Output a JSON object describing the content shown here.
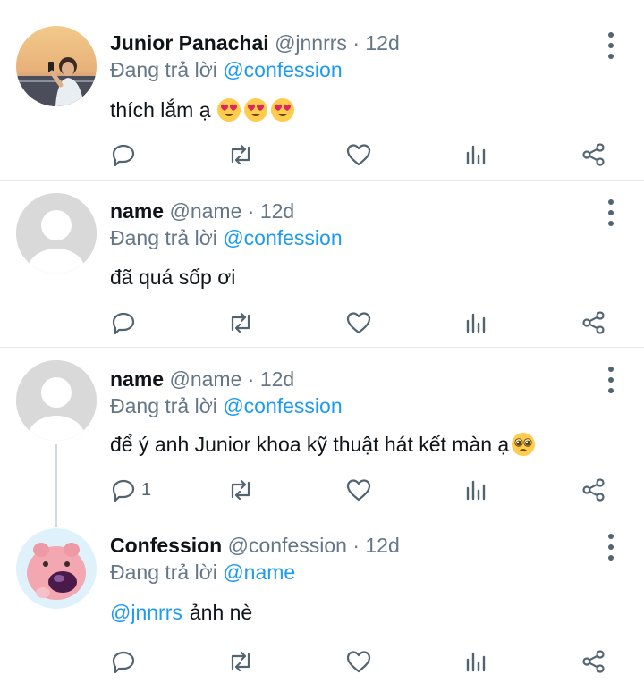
{
  "tweets": [
    {
      "display_name": "Junior Panachai",
      "handle": "@jnnrrs",
      "separator": "·",
      "time": "12d",
      "reply_prefix": "Đang trả lời",
      "reply_to": "@confession",
      "text": "thích lắm ạ",
      "emojis": [
        "heart-eyes-emoji",
        "heart-eyes-emoji",
        "heart-eyes-emoji"
      ],
      "reply_count": ""
    },
    {
      "display_name": "name",
      "handle": "@name",
      "separator": "·",
      "time": "12d",
      "reply_prefix": "Đang trả lời",
      "reply_to": "@confession",
      "text": "đã quá sốp ơi",
      "reply_count": ""
    },
    {
      "display_name": "name",
      "handle": "@name",
      "separator": "·",
      "time": "12d",
      "reply_prefix": "Đang trả lời",
      "reply_to": "@confession",
      "text": "để ý anh Junior khoa kỹ thuật hát kết màn ạ",
      "emojis": [
        "pleading-face-emoji"
      ],
      "reply_count": "1"
    },
    {
      "display_name": "Confession",
      "handle": "@confession",
      "separator": "·",
      "time": "12d",
      "reply_prefix": "Đang trả lời",
      "reply_to": "@name",
      "mention": "@jnnrrs",
      "text": "ảnh nè",
      "reply_count": ""
    }
  ],
  "icons": {
    "reply": "reply-icon",
    "retweet": "retweet-icon",
    "like": "heart-icon",
    "views": "views-icon",
    "share": "share-icon",
    "more": "more-options-icon"
  },
  "colors": {
    "link": "#1d9bf0",
    "muted": "#657786",
    "icon": "#536471",
    "divider": "#e6e9ec"
  }
}
